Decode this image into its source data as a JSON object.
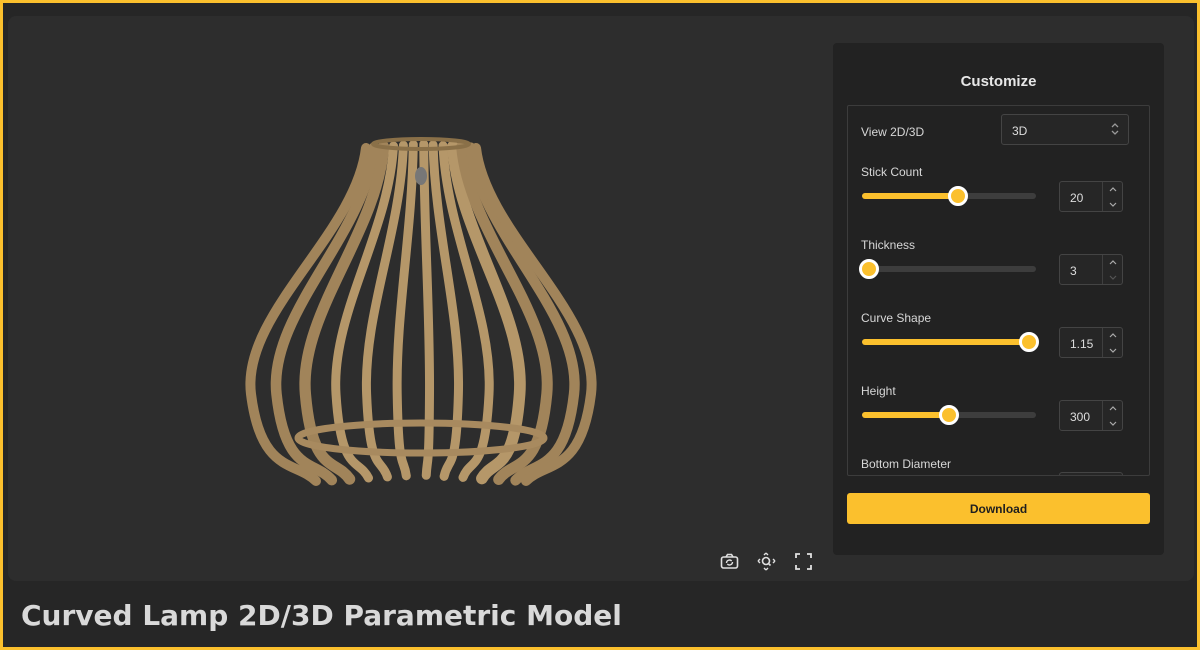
{
  "page_title": "Curved Lamp 2D/3D Parametric Model",
  "panel": {
    "title": "Customize",
    "view_label": "View 2D/3D",
    "view_value": "3D",
    "sliders": [
      {
        "label": "Stick Count",
        "value": "20",
        "fraction": 0.55
      },
      {
        "label": "Thickness",
        "value": "3",
        "fraction": 0.04
      },
      {
        "label": "Curve Shape",
        "value": "1.15",
        "fraction": 0.96
      },
      {
        "label": "Height",
        "value": "300",
        "fraction": 0.5
      }
    ],
    "partial_label": "Bottom Diameter",
    "download_label": "Download"
  },
  "view_tools": [
    "camera-icon",
    "zoom-icon",
    "fullscreen-icon"
  ],
  "colors": {
    "accent": "#fbc02d",
    "background": "#2d2d2d",
    "panel": "#222222",
    "wood": "#a88a5f"
  }
}
